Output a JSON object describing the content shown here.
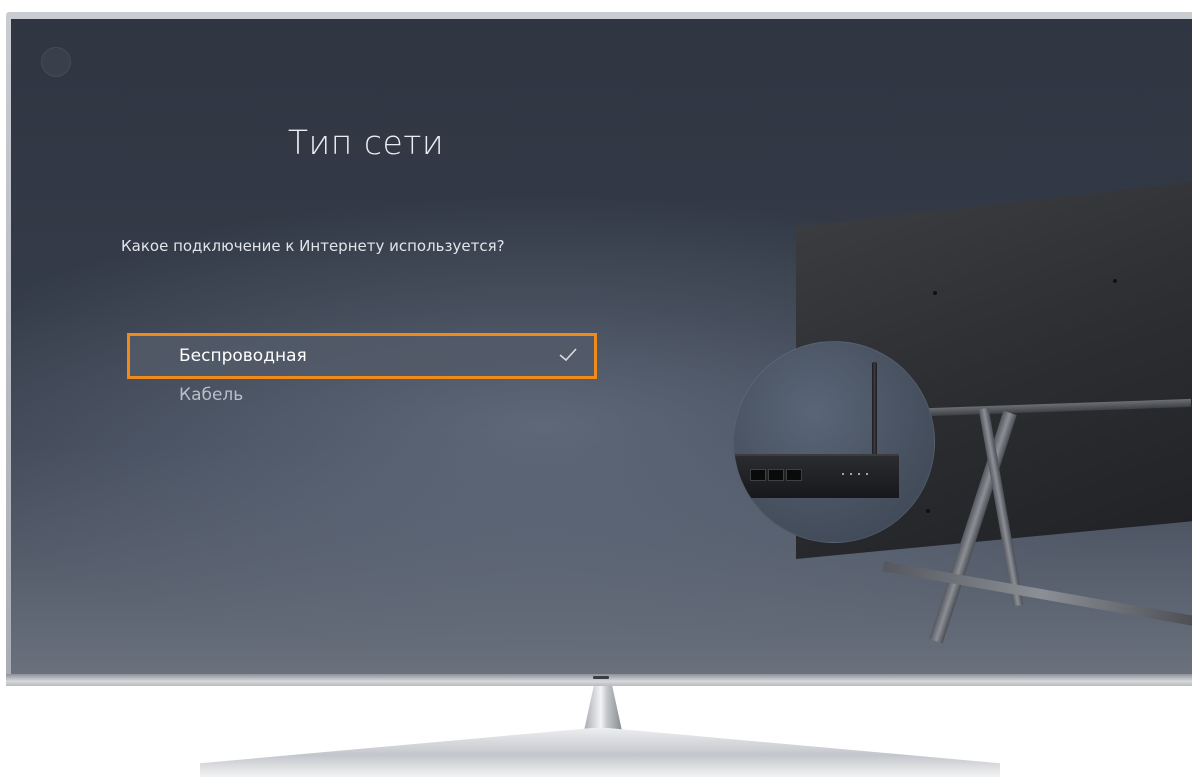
{
  "screen": {
    "title": "Тип сети",
    "question": "Какое подключение к Интернету используется?",
    "options": [
      {
        "label": "Беспроводная",
        "selected": true
      },
      {
        "label": "Кабель",
        "selected": false
      }
    ]
  },
  "colors": {
    "focus_border": "#f08a1a",
    "screen_background": "#353c49",
    "text_primary": "#ffffff",
    "text_secondary": "#b9bfc8"
  },
  "icons": {
    "selected_marker": "checkmark-icon"
  }
}
